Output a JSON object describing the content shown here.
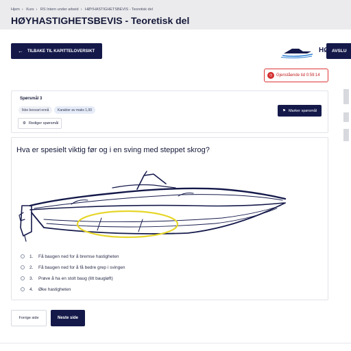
{
  "breadcrumb": [
    "Hjem",
    "Kurs",
    "RS Intern under arbeid",
    "HØYHASTIGHETSBEVIS - Teoretisk del"
  ],
  "breadcrumb_separator": "›",
  "page_title": "HØYHASTIGHETSBEVIS - Teoretisk del",
  "back_button": {
    "icon": "arrow-left-icon",
    "label": "TILBAKE TIL KAPITTELOVERSIKT"
  },
  "logo": {
    "text": "HØ",
    "icon": "speedboat-logo-icon"
  },
  "finish_button": {
    "label": "AVSLU"
  },
  "timer": {
    "icon": "clock-icon",
    "label": "Gjenstående tid 0:59:14"
  },
  "question_card": {
    "number": "Spørsmål 3",
    "status_badge": "Ikke besvart ennå",
    "points_badge": "Karakter av maks 1,00",
    "mark_button": {
      "icon": "flag-icon",
      "label": "Marker spørsmål"
    },
    "edit_button": {
      "icon": "gear-icon",
      "label": "Rediger spørsmål"
    }
  },
  "question": {
    "text": "Hva er spesielt viktig før og i en sving med steppet skrog?",
    "image": "speedboat-illustration-with-stepped-hull-highlighted",
    "highlight_color": "#e6d62a",
    "options": [
      {
        "num": "1.",
        "text": "Få baugen ned for å bremse hastigheten"
      },
      {
        "num": "2.",
        "text": "Få baugen ned for å få bedre grep i svingen"
      },
      {
        "num": "3.",
        "text": "Prøve å ha en stolt baug (litt baugløft)"
      },
      {
        "num": "4.",
        "text": "Øke hastigheten"
      }
    ]
  },
  "nav": {
    "prev_label": "Forrige side",
    "next_label": "Neste side"
  },
  "colors": {
    "primary": "#14194a",
    "danger": "#d32f2f",
    "topbar": "#ebebed"
  }
}
